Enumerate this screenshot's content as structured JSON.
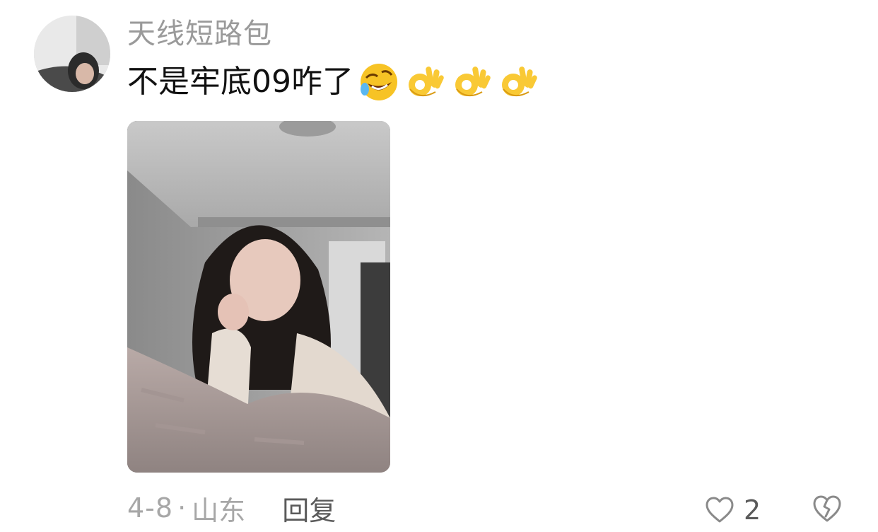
{
  "comment": {
    "username": "天线短路包",
    "text": "不是牢底09咋了",
    "emojis": [
      "rofl-emoji",
      "ok-hand-emoji",
      "ok-hand-emoji",
      "ok-hand-emoji"
    ],
    "date": "4-8",
    "separator": "·",
    "location": "山东",
    "reply_label": "回复",
    "like_count": "2"
  },
  "icons": {
    "like": "heart-outline-icon",
    "dislike": "broken-heart-icon"
  },
  "colors": {
    "username": "#9a9a9a",
    "text": "#111111",
    "meta": "#a7a7a7",
    "reply": "#5a5a5a",
    "icon": "#8a8a8a"
  }
}
